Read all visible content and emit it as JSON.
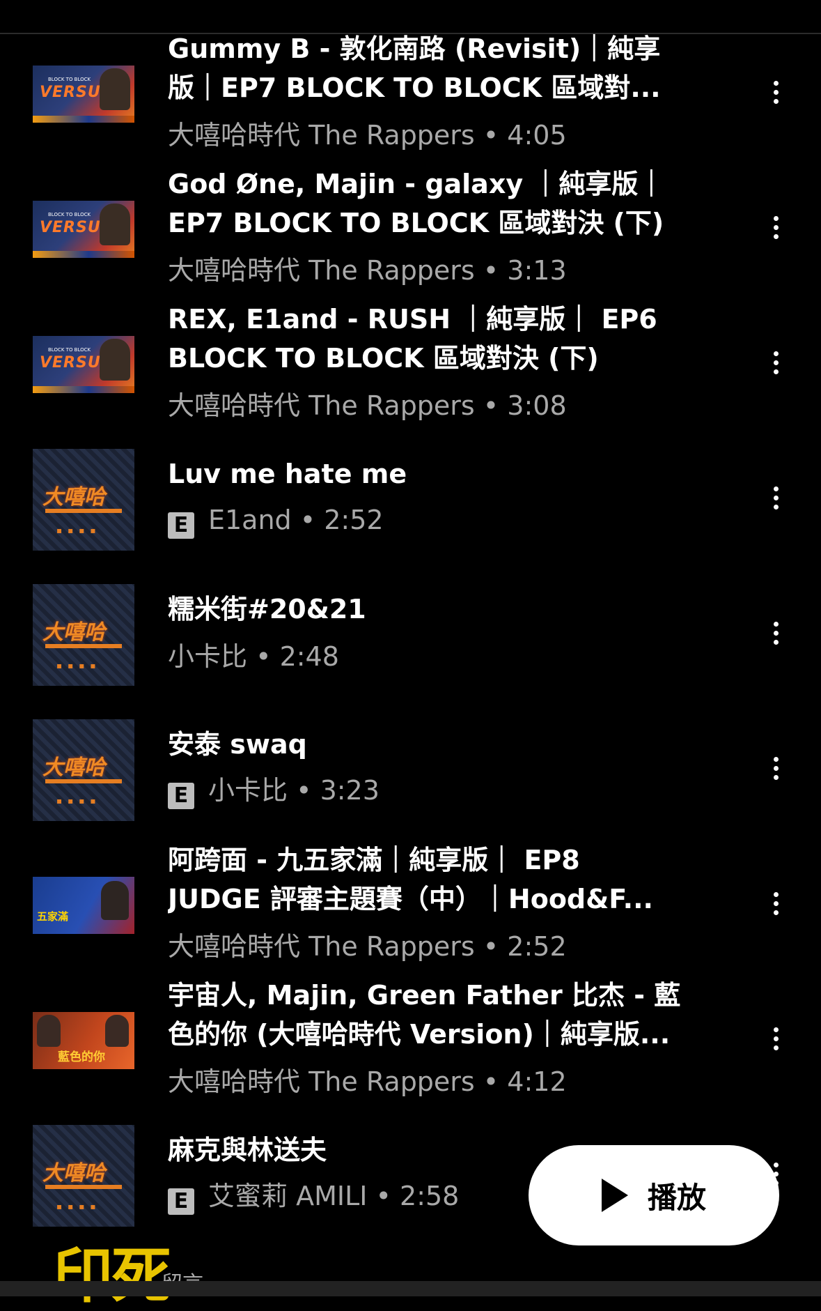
{
  "tracks": [
    {
      "title_lines": [
        "Gummy B - 敦化南路 (Revisit)｜純享",
        "版｜EP7 BLOCK TO BLOCK 區域對..."
      ],
      "explicit": false,
      "meta": "大嘻哈時代 The Rappers • 4:05",
      "art": "versus"
    },
    {
      "title_lines": [
        "God Øne, Majin - galaxy ｜純享版｜",
        "EP7 BLOCK TO BLOCK 區域對決 (下)"
      ],
      "explicit": false,
      "meta": "大嘻哈時代 The Rappers • 3:13",
      "art": "versus"
    },
    {
      "title_lines": [
        "REX, E1and - RUSH ｜純享版｜ EP6",
        "BLOCK TO BLOCK 區域對決 (下)"
      ],
      "explicit": false,
      "meta": "大嘻哈時代 The Rappers • 3:08",
      "art": "versus"
    },
    {
      "title_lines": [
        "Luv me hate me"
      ],
      "explicit": true,
      "meta": "E1and • 2:52",
      "art": "cover"
    },
    {
      "title_lines": [
        "糯米街#20&21"
      ],
      "explicit": false,
      "meta": "小卡比 • 2:48",
      "art": "cover"
    },
    {
      "title_lines": [
        "安泰 swaq"
      ],
      "explicit": true,
      "meta": "小卡比 • 3:23",
      "art": "cover"
    },
    {
      "title_lines": [
        "阿跨面 - 九五家滿｜純享版｜ EP8",
        "JUDGE 評審主題賽（中）｜Hood&F..."
      ],
      "explicit": false,
      "meta": "大嘻哈時代 The Rappers • 2:52",
      "art": "judge"
    },
    {
      "title_lines": [
        "宇宙人, Majin, Green Father 比杰 - 藍",
        "色的你 (大嘻哈時代 Version)｜純享版..."
      ],
      "explicit": false,
      "meta": "大嘻哈時代 The Rappers • 4:12",
      "art": "blue"
    },
    {
      "title_lines": [
        "麻克與林送夫"
      ],
      "explicit": true,
      "meta": "艾蜜莉 AMILI • 2:58",
      "art": "cover"
    }
  ],
  "thumb_text": {
    "versus": "VERSUS",
    "versus_sub": "BLOCK TO BLOCK",
    "cover": "大嘻哈",
    "judge": "五家滿",
    "blue": "藍色的你"
  },
  "explicit_badge": "E",
  "play_button": {
    "label": "播放"
  },
  "bottom": {
    "logo": "印死",
    "tab": "留言"
  },
  "icons": {
    "more": "more-vert-icon",
    "play": "play-icon",
    "explicit": "explicit-badge"
  }
}
